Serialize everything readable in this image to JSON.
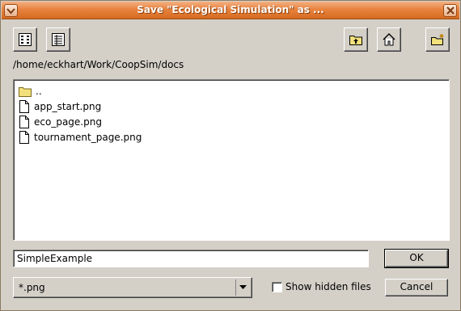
{
  "window": {
    "title": "Save \"Ecological Simulation\" as ..."
  },
  "toolbar": {
    "left_icons": [
      "list-view-icon",
      "details-view-icon"
    ],
    "right_icons": [
      "parent-folder-icon",
      "home-icon",
      "new-folder-icon"
    ]
  },
  "path": "/home/eckhart/Work/CoopSim/docs",
  "files": [
    {
      "name": "..",
      "type": "folder"
    },
    {
      "name": "app_start.png",
      "type": "file"
    },
    {
      "name": "eco_page.png",
      "type": "file"
    },
    {
      "name": "tournament_page.png",
      "type": "file"
    }
  ],
  "filename": {
    "value": "SimpleExample"
  },
  "buttons": {
    "ok": "OK",
    "cancel": "Cancel"
  },
  "filter": {
    "selected": "*.png"
  },
  "hidden_files": {
    "label": "Show hidden files",
    "checked": false
  },
  "colors": {
    "titlebar": "#e7833f",
    "window_bg": "#d4d0c8",
    "folder": "#f2e07c"
  }
}
